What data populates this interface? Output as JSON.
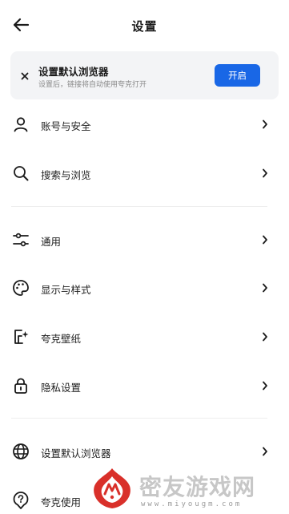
{
  "header": {
    "title": "设置",
    "back_icon": "arrow-left-icon"
  },
  "banner": {
    "title": "设置默认浏览器",
    "subtitle": "设置后，链接将自动使用夸克打开",
    "button_label": "开启",
    "close_icon": "close-icon",
    "accent_color": "#1967e6"
  },
  "settings": {
    "items": [
      {
        "label": "账号与安全",
        "icon": "user-icon"
      },
      {
        "label": "搜索与浏览",
        "icon": "search-icon"
      },
      {
        "label": "通用",
        "icon": "sliders-icon"
      },
      {
        "label": "显示与样式",
        "icon": "palette-icon"
      },
      {
        "label": "夸克壁纸",
        "icon": "wallpaper-icon"
      },
      {
        "label": "隐私设置",
        "icon": "lock-icon"
      },
      {
        "label": "设置默认浏览器",
        "icon": "globe-icon"
      },
      {
        "label": "夸克使用",
        "icon": "help-location-icon"
      }
    ],
    "chevron_icon": "chevron-right-icon"
  },
  "watermark": {
    "name": "密友游戏网",
    "url": "www.miyougm.com",
    "logo_icon": "miyou-logo-icon"
  }
}
